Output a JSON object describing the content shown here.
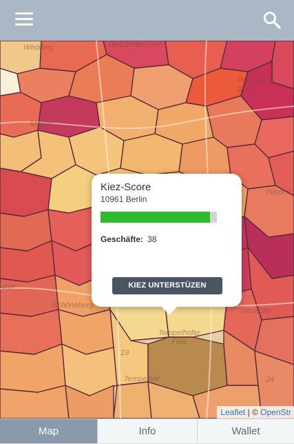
{
  "header": {
    "menu_icon": "hamburger-menu-icon",
    "search_icon": "search-icon"
  },
  "map": {
    "labels": [
      "Wedding",
      "Gesundbrunnen",
      "Prenzlauer Berg",
      "Moabit",
      "Friedric",
      "dorf",
      "Schöneberg",
      "Neukölln",
      "Tempelhofer Feld",
      "Tempelhof",
      "19",
      "24"
    ],
    "attribution": {
      "leaflet": "Leaflet",
      "separator": " | © ",
      "osm": "OpenStr"
    }
  },
  "popup": {
    "title": "Kiez-Score",
    "subtitle": "10961 Berlin",
    "score_fraction": 0.94,
    "score_color": "#2fb92f",
    "stat_label": "Geschäfte:",
    "stat_value": "38",
    "button_label": "KIEZ UNTERSTÜZEN"
  },
  "tabs": [
    {
      "label": "Map",
      "active": true
    },
    {
      "label": "Info",
      "active": false
    },
    {
      "label": "Wallet",
      "active": false
    }
  ],
  "colors": {
    "header": "#aab7c5",
    "active_tab": "#8a9aad",
    "button": "#4a5563"
  }
}
